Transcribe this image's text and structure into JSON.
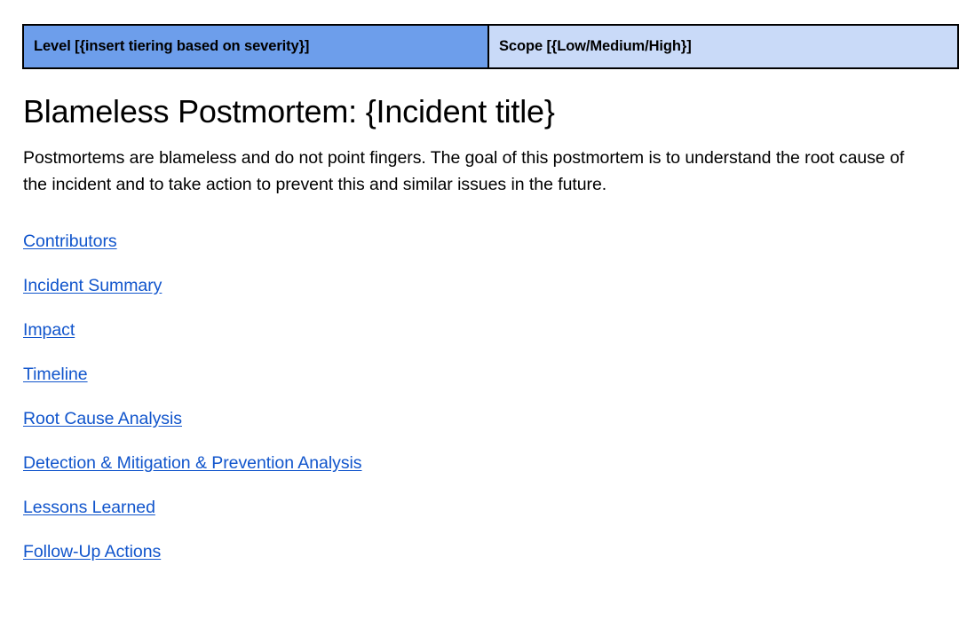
{
  "document": {
    "title": "Blameless Postmortem: {Incident title}",
    "intro": "Postmortems are blameless and do not point fingers. The goal of this postmortem is to understand the root cause of the incident and to take action to prevent this and similar issues in the future."
  },
  "meta_table": {
    "level_cell": "Level [{insert tiering based on severity}]",
    "scope_cell": "Scope [{Low/Medium/High}]",
    "colors": {
      "level_background": "#6d9eeb",
      "scope_background": "#c9daf8",
      "border": "#000000"
    }
  },
  "table_of_contents": {
    "link_color": "#1155cc",
    "items": [
      {
        "label": "Contributors"
      },
      {
        "label": "Incident Summary"
      },
      {
        "label": "Impact"
      },
      {
        "label": "Timeline"
      },
      {
        "label": "Root Cause Analysis"
      },
      {
        "label": "Detection & Mitigation & Prevention Analysis"
      },
      {
        "label": "Lessons Learned"
      },
      {
        "label": "Follow-Up Actions"
      }
    ]
  }
}
